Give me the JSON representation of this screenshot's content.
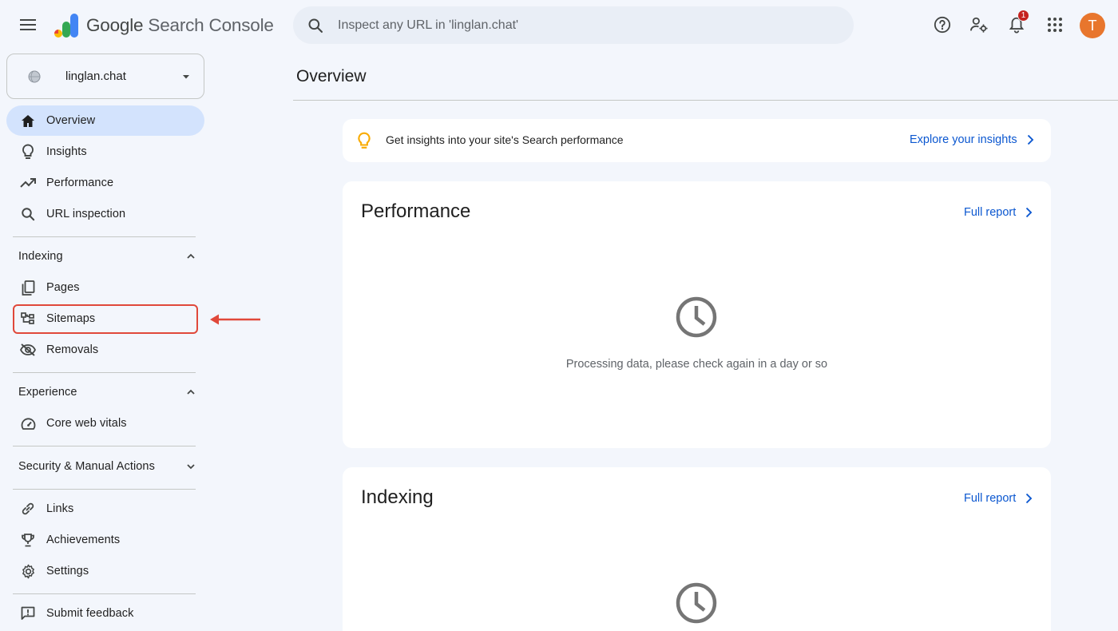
{
  "header": {
    "product_name_brand": "Google",
    "product_name_rest": " Search Console",
    "search_placeholder": "Inspect any URL in 'linglan.chat'",
    "notification_count": "1",
    "avatar_letter": "T"
  },
  "sidebar": {
    "property": "linglan.chat",
    "items": [
      {
        "label": "Overview",
        "icon": "home-icon",
        "active": true
      },
      {
        "label": "Insights",
        "icon": "lightbulb-icon"
      },
      {
        "label": "Performance",
        "icon": "trending-up-icon"
      },
      {
        "label": "URL inspection",
        "icon": "search-icon"
      }
    ],
    "indexing": {
      "heading": "Indexing",
      "items": [
        {
          "label": "Pages",
          "icon": "pages-icon"
        },
        {
          "label": "Sitemaps",
          "icon": "sitemap-icon"
        },
        {
          "label": "Removals",
          "icon": "visibility-off-icon"
        }
      ]
    },
    "experience": {
      "heading": "Experience",
      "items": [
        {
          "label": "Core web vitals",
          "icon": "speedometer-icon"
        }
      ]
    },
    "security": {
      "heading": "Security & Manual Actions"
    },
    "other": [
      {
        "label": "Links",
        "icon": "link-icon"
      },
      {
        "label": "Achievements",
        "icon": "trophy-icon"
      },
      {
        "label": "Settings",
        "icon": "gear-icon"
      }
    ],
    "feedback": {
      "label": "Submit feedback",
      "icon": "feedback-icon"
    }
  },
  "main": {
    "title": "Overview",
    "insights_banner": {
      "text": "Get insights into your site's Search performance",
      "link": "Explore your insights"
    },
    "cards": [
      {
        "title": "Performance",
        "link": "Full report",
        "status": "Processing data, please check again in a day or so"
      },
      {
        "title": "Indexing",
        "link": "Full report"
      }
    ]
  },
  "colors": {
    "accent": "#0b57d0",
    "active_nav": "#d3e3fd",
    "background": "#f3f6fc",
    "highlight": "#e0483a",
    "avatar": "#e8762d"
  }
}
